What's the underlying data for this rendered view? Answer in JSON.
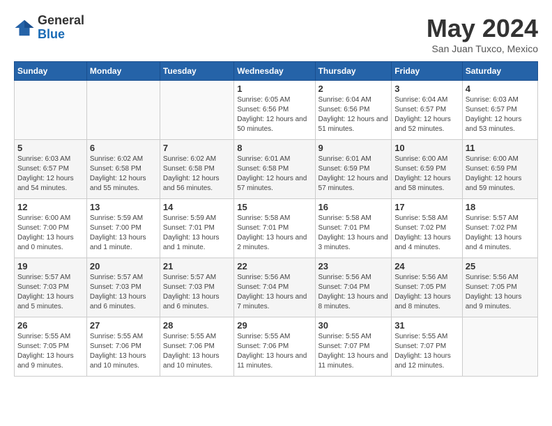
{
  "logo": {
    "general": "General",
    "blue": "Blue"
  },
  "header": {
    "month": "May 2024",
    "location": "San Juan Tuxco, Mexico"
  },
  "weekdays": [
    "Sunday",
    "Monday",
    "Tuesday",
    "Wednesday",
    "Thursday",
    "Friday",
    "Saturday"
  ],
  "weeks": [
    [
      {
        "day": "",
        "sunrise": "",
        "sunset": "",
        "daylight": ""
      },
      {
        "day": "",
        "sunrise": "",
        "sunset": "",
        "daylight": ""
      },
      {
        "day": "",
        "sunrise": "",
        "sunset": "",
        "daylight": ""
      },
      {
        "day": "1",
        "sunrise": "Sunrise: 6:05 AM",
        "sunset": "Sunset: 6:56 PM",
        "daylight": "Daylight: 12 hours and 50 minutes."
      },
      {
        "day": "2",
        "sunrise": "Sunrise: 6:04 AM",
        "sunset": "Sunset: 6:56 PM",
        "daylight": "Daylight: 12 hours and 51 minutes."
      },
      {
        "day": "3",
        "sunrise": "Sunrise: 6:04 AM",
        "sunset": "Sunset: 6:57 PM",
        "daylight": "Daylight: 12 hours and 52 minutes."
      },
      {
        "day": "4",
        "sunrise": "Sunrise: 6:03 AM",
        "sunset": "Sunset: 6:57 PM",
        "daylight": "Daylight: 12 hours and 53 minutes."
      }
    ],
    [
      {
        "day": "5",
        "sunrise": "Sunrise: 6:03 AM",
        "sunset": "Sunset: 6:57 PM",
        "daylight": "Daylight: 12 hours and 54 minutes."
      },
      {
        "day": "6",
        "sunrise": "Sunrise: 6:02 AM",
        "sunset": "Sunset: 6:58 PM",
        "daylight": "Daylight: 12 hours and 55 minutes."
      },
      {
        "day": "7",
        "sunrise": "Sunrise: 6:02 AM",
        "sunset": "Sunset: 6:58 PM",
        "daylight": "Daylight: 12 hours and 56 minutes."
      },
      {
        "day": "8",
        "sunrise": "Sunrise: 6:01 AM",
        "sunset": "Sunset: 6:58 PM",
        "daylight": "Daylight: 12 hours and 57 minutes."
      },
      {
        "day": "9",
        "sunrise": "Sunrise: 6:01 AM",
        "sunset": "Sunset: 6:59 PM",
        "daylight": "Daylight: 12 hours and 57 minutes."
      },
      {
        "day": "10",
        "sunrise": "Sunrise: 6:00 AM",
        "sunset": "Sunset: 6:59 PM",
        "daylight": "Daylight: 12 hours and 58 minutes."
      },
      {
        "day": "11",
        "sunrise": "Sunrise: 6:00 AM",
        "sunset": "Sunset: 6:59 PM",
        "daylight": "Daylight: 12 hours and 59 minutes."
      }
    ],
    [
      {
        "day": "12",
        "sunrise": "Sunrise: 6:00 AM",
        "sunset": "Sunset: 7:00 PM",
        "daylight": "Daylight: 13 hours and 0 minutes."
      },
      {
        "day": "13",
        "sunrise": "Sunrise: 5:59 AM",
        "sunset": "Sunset: 7:00 PM",
        "daylight": "Daylight: 13 hours and 1 minute."
      },
      {
        "day": "14",
        "sunrise": "Sunrise: 5:59 AM",
        "sunset": "Sunset: 7:01 PM",
        "daylight": "Daylight: 13 hours and 1 minute."
      },
      {
        "day": "15",
        "sunrise": "Sunrise: 5:58 AM",
        "sunset": "Sunset: 7:01 PM",
        "daylight": "Daylight: 13 hours and 2 minutes."
      },
      {
        "day": "16",
        "sunrise": "Sunrise: 5:58 AM",
        "sunset": "Sunset: 7:01 PM",
        "daylight": "Daylight: 13 hours and 3 minutes."
      },
      {
        "day": "17",
        "sunrise": "Sunrise: 5:58 AM",
        "sunset": "Sunset: 7:02 PM",
        "daylight": "Daylight: 13 hours and 4 minutes."
      },
      {
        "day": "18",
        "sunrise": "Sunrise: 5:57 AM",
        "sunset": "Sunset: 7:02 PM",
        "daylight": "Daylight: 13 hours and 4 minutes."
      }
    ],
    [
      {
        "day": "19",
        "sunrise": "Sunrise: 5:57 AM",
        "sunset": "Sunset: 7:03 PM",
        "daylight": "Daylight: 13 hours and 5 minutes."
      },
      {
        "day": "20",
        "sunrise": "Sunrise: 5:57 AM",
        "sunset": "Sunset: 7:03 PM",
        "daylight": "Daylight: 13 hours and 6 minutes."
      },
      {
        "day": "21",
        "sunrise": "Sunrise: 5:57 AM",
        "sunset": "Sunset: 7:03 PM",
        "daylight": "Daylight: 13 hours and 6 minutes."
      },
      {
        "day": "22",
        "sunrise": "Sunrise: 5:56 AM",
        "sunset": "Sunset: 7:04 PM",
        "daylight": "Daylight: 13 hours and 7 minutes."
      },
      {
        "day": "23",
        "sunrise": "Sunrise: 5:56 AM",
        "sunset": "Sunset: 7:04 PM",
        "daylight": "Daylight: 13 hours and 8 minutes."
      },
      {
        "day": "24",
        "sunrise": "Sunrise: 5:56 AM",
        "sunset": "Sunset: 7:05 PM",
        "daylight": "Daylight: 13 hours and 8 minutes."
      },
      {
        "day": "25",
        "sunrise": "Sunrise: 5:56 AM",
        "sunset": "Sunset: 7:05 PM",
        "daylight": "Daylight: 13 hours and 9 minutes."
      }
    ],
    [
      {
        "day": "26",
        "sunrise": "Sunrise: 5:55 AM",
        "sunset": "Sunset: 7:05 PM",
        "daylight": "Daylight: 13 hours and 9 minutes."
      },
      {
        "day": "27",
        "sunrise": "Sunrise: 5:55 AM",
        "sunset": "Sunset: 7:06 PM",
        "daylight": "Daylight: 13 hours and 10 minutes."
      },
      {
        "day": "28",
        "sunrise": "Sunrise: 5:55 AM",
        "sunset": "Sunset: 7:06 PM",
        "daylight": "Daylight: 13 hours and 10 minutes."
      },
      {
        "day": "29",
        "sunrise": "Sunrise: 5:55 AM",
        "sunset": "Sunset: 7:06 PM",
        "daylight": "Daylight: 13 hours and 11 minutes."
      },
      {
        "day": "30",
        "sunrise": "Sunrise: 5:55 AM",
        "sunset": "Sunset: 7:07 PM",
        "daylight": "Daylight: 13 hours and 11 minutes."
      },
      {
        "day": "31",
        "sunrise": "Sunrise: 5:55 AM",
        "sunset": "Sunset: 7:07 PM",
        "daylight": "Daylight: 13 hours and 12 minutes."
      },
      {
        "day": "",
        "sunrise": "",
        "sunset": "",
        "daylight": ""
      }
    ]
  ]
}
